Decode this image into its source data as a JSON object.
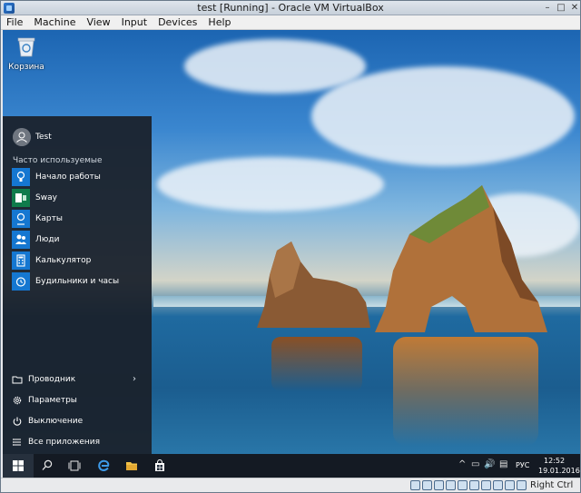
{
  "window": {
    "title": "test [Running] - Oracle VM VirtualBox",
    "controls": {
      "minimize": "–",
      "maximize": "□",
      "close": "✕"
    }
  },
  "menubar": [
    "File",
    "Machine",
    "View",
    "Input",
    "Devices",
    "Help"
  ],
  "desktop": {
    "icons": [
      {
        "label": "Корзина",
        "icon": "recycle-bin-icon"
      }
    ]
  },
  "start_menu": {
    "user": "Test",
    "section_title": "Часто используемые",
    "apps": [
      {
        "label": "Начало работы",
        "icon": "lightbulb-icon",
        "color": "#1577d1"
      },
      {
        "label": "Sway",
        "icon": "sway-icon",
        "color": "#0f7b4b"
      },
      {
        "label": "Карты",
        "icon": "maps-icon",
        "color": "#1577d1"
      },
      {
        "label": "Люди",
        "icon": "people-icon",
        "color": "#1577d1"
      },
      {
        "label": "Калькулятор",
        "icon": "calculator-icon",
        "color": "#1577d1"
      },
      {
        "label": "Будильники и часы",
        "icon": "alarm-clock-icon",
        "color": "#1577d1"
      }
    ],
    "bottom": [
      {
        "label": "Проводник",
        "icon": "folder-icon"
      },
      {
        "label": "Параметры",
        "icon": "gear-icon"
      },
      {
        "label": "Выключение",
        "icon": "power-icon"
      },
      {
        "label": "Все приложения",
        "icon": "all-apps-icon"
      }
    ]
  },
  "taskbar": {
    "language": "РУС",
    "time": "12:52",
    "date": "19.01.2016",
    "tray_glyphs": [
      "^",
      "▭",
      "🔊",
      "▤"
    ]
  },
  "statusbar": {
    "host_key": "Right Ctrl"
  }
}
